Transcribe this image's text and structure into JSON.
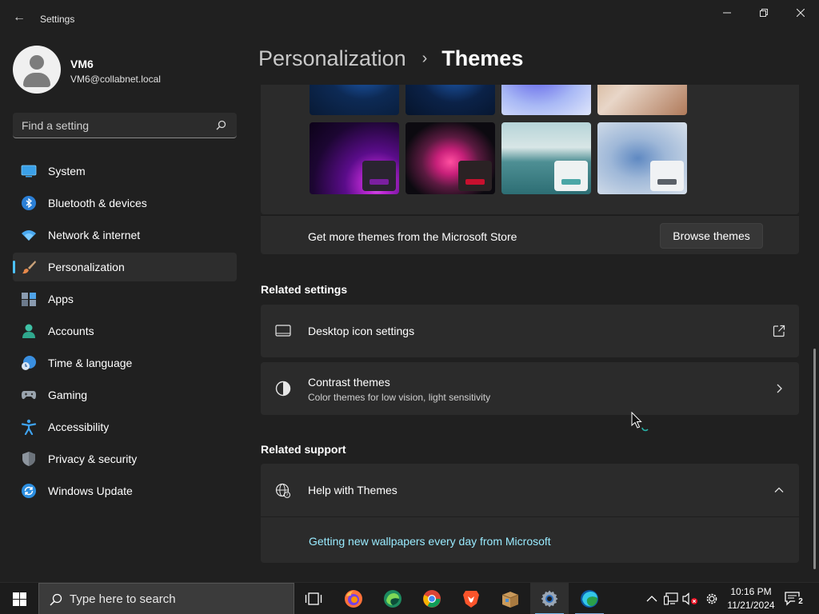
{
  "window": {
    "title": "Settings",
    "back_glyph": "←",
    "controls": {
      "minimize": "minimize-icon",
      "maximize": "restore-icon",
      "close": "close-icon"
    }
  },
  "profile": {
    "name": "VM6",
    "email": "VM6@collabnet.local"
  },
  "search": {
    "placeholder": "Find a setting"
  },
  "sidebar": {
    "items": [
      {
        "label": "System",
        "icon": "system-icon",
        "active": false
      },
      {
        "label": "Bluetooth & devices",
        "icon": "bluetooth-icon",
        "active": false
      },
      {
        "label": "Network & internet",
        "icon": "wifi-icon",
        "active": false
      },
      {
        "label": "Personalization",
        "icon": "brush-icon",
        "active": true
      },
      {
        "label": "Apps",
        "icon": "apps-icon",
        "active": false
      },
      {
        "label": "Accounts",
        "icon": "accounts-icon",
        "active": false
      },
      {
        "label": "Time & language",
        "icon": "time-language-icon",
        "active": false
      },
      {
        "label": "Gaming",
        "icon": "gamepad-icon",
        "active": false
      },
      {
        "label": "Accessibility",
        "icon": "accessibility-icon",
        "active": false
      },
      {
        "label": "Privacy & security",
        "icon": "shield-icon",
        "active": false
      },
      {
        "label": "Windows Update",
        "icon": "update-icon",
        "active": false
      }
    ]
  },
  "breadcrumb": {
    "parent": "Personalization",
    "separator": "›",
    "current": "Themes"
  },
  "themes": {
    "accent_colors": [
      "#0a78d4",
      "#0a78d4",
      "#8b83c9",
      "#0a78d4",
      "#7a1fa0",
      "#c8102e",
      "#4aa6a6",
      "#5a6068"
    ],
    "store_text": "Get more themes from the Microsoft Store",
    "browse_label": "Browse themes"
  },
  "related_settings": {
    "title": "Related settings",
    "items": [
      {
        "title": "Desktop icon settings",
        "subtitle": "",
        "icon": "monitor-icon",
        "trailing": "external-link-icon"
      },
      {
        "title": "Contrast themes",
        "subtitle": "Color themes for low vision, light sensitivity",
        "icon": "contrast-icon",
        "trailing": "chevron-right-icon"
      }
    ]
  },
  "related_support": {
    "title": "Related support",
    "help_title": "Help with Themes",
    "help_icon": "globe-icon",
    "help_trailing": "chevron-up-icon",
    "link": "Getting new wallpapers every day from Microsoft"
  },
  "taskbar": {
    "search_placeholder": "Type here to search",
    "apps": [
      "task-view-icon",
      "firefox-icon",
      "edge-dev-icon",
      "chrome-icon",
      "brave-icon",
      "package-icon",
      "settings-icon",
      "edge-icon"
    ],
    "tray": [
      "chevron-up-icon",
      "network-icon",
      "volume-muted-icon",
      "gear-icon"
    ],
    "time": "10:16 PM",
    "date": "11/21/2024",
    "notifications": "2"
  }
}
